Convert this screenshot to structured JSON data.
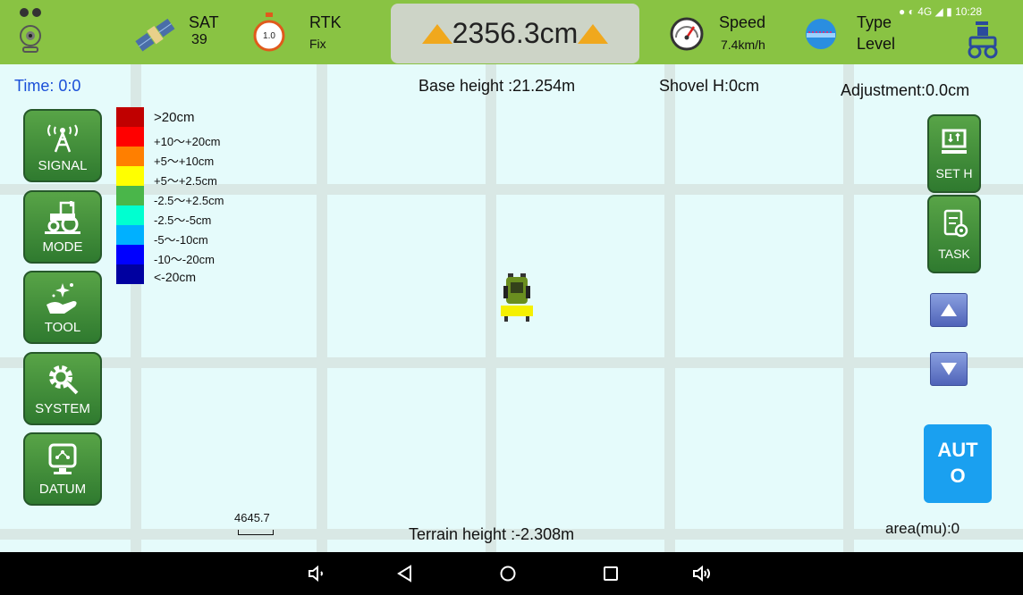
{
  "topbar": {
    "sat_label": "SAT",
    "sat_value": "39",
    "timer_value": "1.0",
    "rtk_label": "RTK",
    "rtk_value": "Fix",
    "height_value": "2356.3cm",
    "speed_label": "Speed",
    "speed_value": "7.4km/h",
    "type_label": "Type",
    "type_value": "Level",
    "clock": "10:28",
    "network": "4G"
  },
  "map": {
    "time_label": "Time: 0:0",
    "base_height": "Base height :21.254m",
    "shovel_height": "Shovel H:0cm",
    "adjustment": "Adjustment:0.0cm",
    "terrain_height": "Terrain height :-2.308m",
    "area": "area(mu):0",
    "scale_value": "4645.7"
  },
  "legend": [
    {
      "label": ">20cm",
      "color": "#c00000"
    },
    {
      "label": "+10〜+20cm",
      "color": "#ff0000"
    },
    {
      "label": "+5〜+10cm",
      "color": "#ff7f00"
    },
    {
      "label": "+5〜+2.5cm",
      "color": "#ffff00"
    },
    {
      "label": "-2.5〜+2.5cm",
      "color": "#4ab64a"
    },
    {
      "label": "-2.5〜-5cm",
      "color": "#00ffd0"
    },
    {
      "label": "-5〜-10cm",
      "color": "#00b0ff"
    },
    {
      "label": "-10〜-20cm",
      "color": "#0000ff"
    },
    {
      "label": "<-20cm",
      "color": "#0000a0"
    }
  ],
  "left_buttons": {
    "signal": "SIGNAL",
    "mode": "MODE",
    "tool": "TOOL",
    "system": "SYSTEM",
    "datum": "DATUM"
  },
  "right_buttons": {
    "set_h": "SET H",
    "task": "TASK",
    "auto_line1": "AUT",
    "auto_line2": "O"
  },
  "colors": {
    "topbar": "#89c343",
    "map_bg": "#e5fbfb",
    "button_green": "#3a8a35",
    "auto_blue": "#1aa0f0",
    "arrow_blue": "#5b6fc4",
    "height_triangle": "#f0a81d"
  }
}
